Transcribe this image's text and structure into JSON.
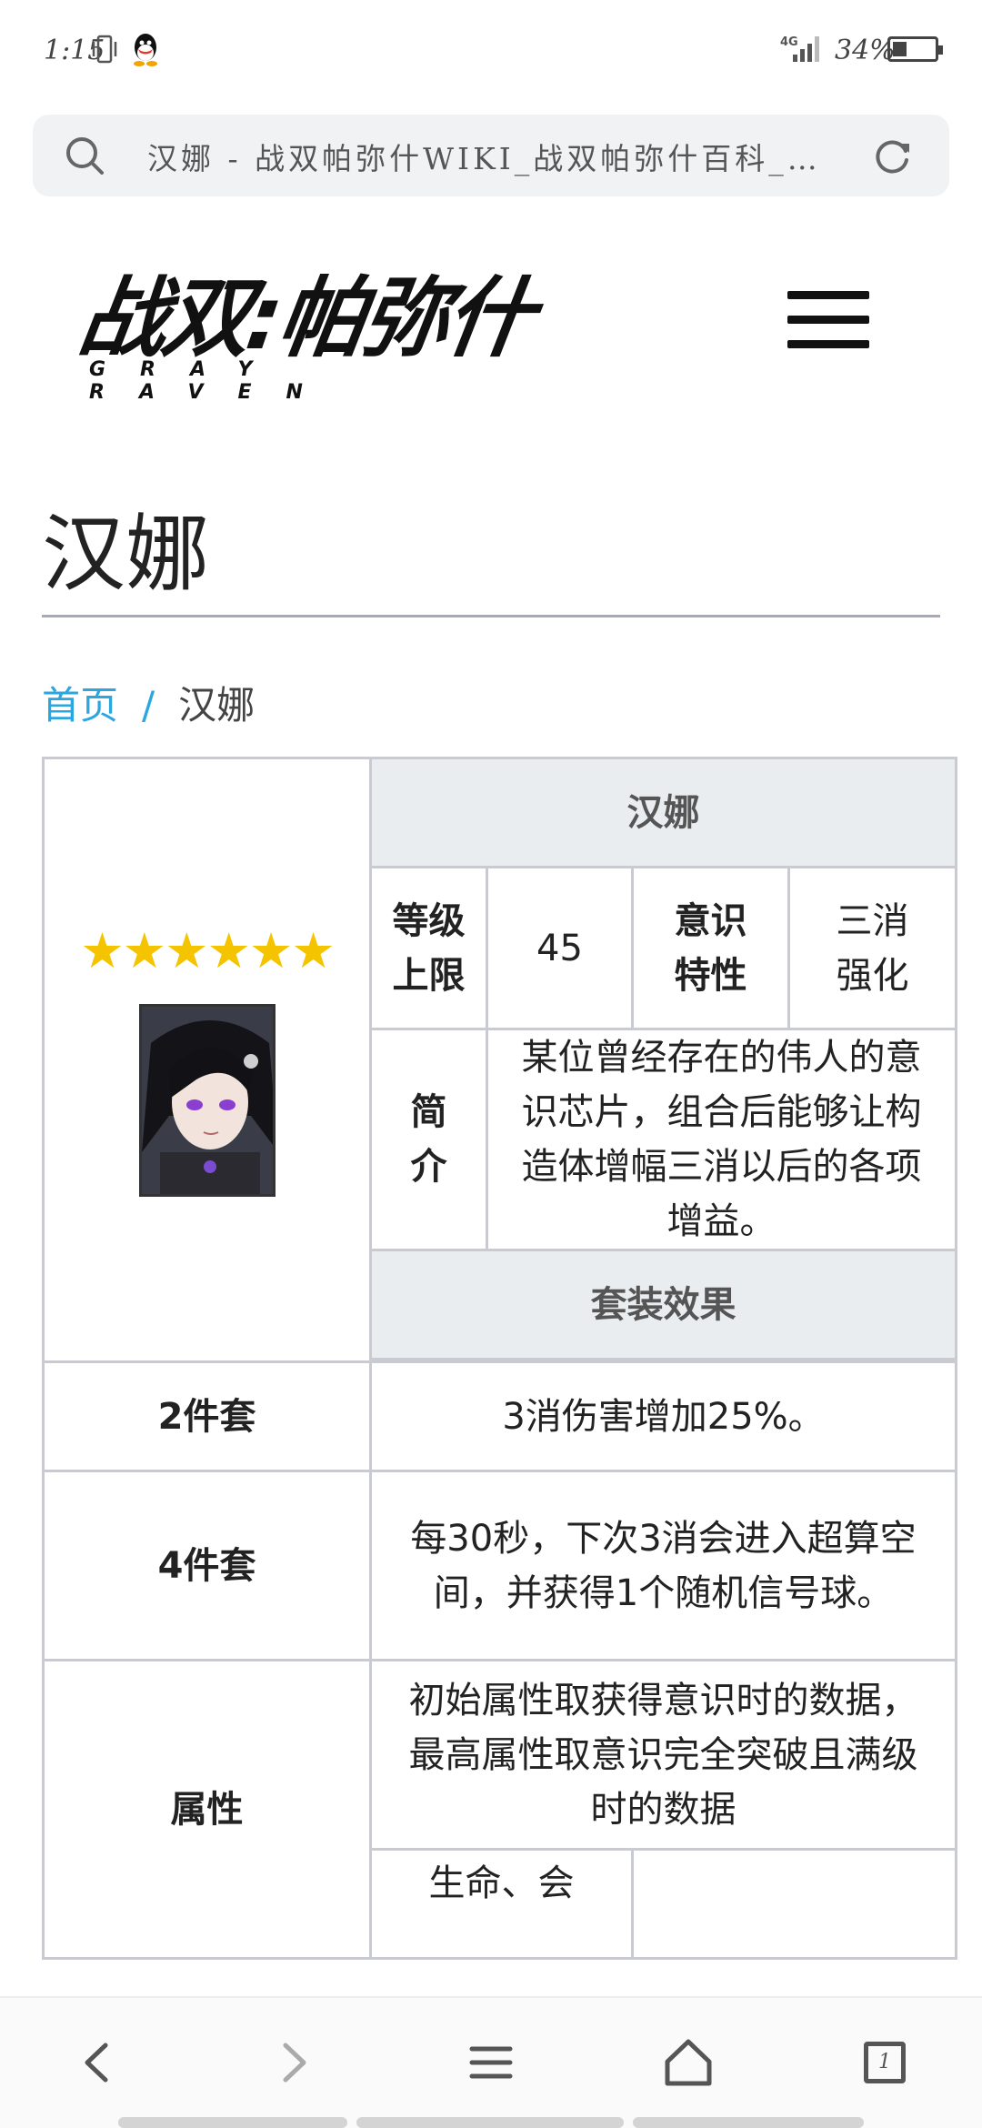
{
  "status_bar": {
    "time": "1:15",
    "network": "4G",
    "battery": "34%",
    "battery_level": 0.34,
    "icons": [
      "vibrate-icon",
      "qq-icon",
      "signal-icon",
      "battery-icon"
    ]
  },
  "browser": {
    "url_text": "汉娜 - 战双帕弥什WIKI_战双帕弥什百科_…",
    "icons": [
      "search-icon",
      "reload-icon"
    ]
  },
  "site": {
    "logo_main": "战双:帕弥什",
    "logo_sub": "GRAY RAVEN",
    "menu_icon": "hamburger-menu-icon"
  },
  "page": {
    "title": "汉娜",
    "breadcrumb": {
      "home": "首页",
      "separator": "/",
      "current": "汉娜"
    }
  },
  "infobox": {
    "stars": "★★★★★★",
    "star_count": 6,
    "name": "汉娜",
    "level_cap_label": "等级上限",
    "level_cap_value": "45",
    "trait_label": "意识特性",
    "trait_value": "三消强化",
    "intro_label": "简介",
    "intro_text": "某位曾经存在的伟人的意识芯片，组合后能够让构造体增幅三消以后的各项增益。",
    "set_effect_header": "套装效果",
    "set2_label": "2件套",
    "set2_text": "3消伤害增加25%。",
    "set4_label": "4件套",
    "set4_text": "每30秒，下次3消会进入超算空间，并获得1个随机信号球。",
    "attr_label": "属性",
    "attr_note": "初始属性取获得意识时的数据，最高属性取意识完全突破且满级时的数据",
    "attr_partial": "生命、会"
  },
  "bottom_nav": {
    "icons": [
      "back-icon",
      "forward-icon",
      "menu-icon",
      "home-icon",
      "tabs-icon"
    ],
    "tab_count": "1"
  },
  "colors": {
    "accent": "#2ba6e0",
    "star": "#f5c400",
    "table_header_bg": "#eaedf0",
    "border": "#c9cbd1"
  }
}
